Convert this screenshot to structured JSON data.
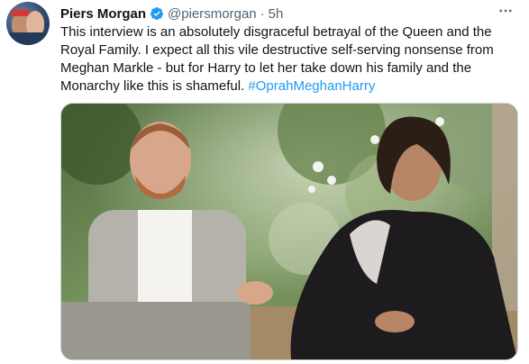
{
  "tweet": {
    "author_name": "Piers Morgan",
    "handle": "@piersmorgan",
    "separator": "·",
    "time": "5h",
    "text": "This interview is an absolutely disgraceful betrayal of the Queen and the Royal Family. I expect all this vile destructive self-serving nonsense from Meghan Markle - but for Harry to let her take down his family and the Monarchy like this is shameful.",
    "hashtag": "#OprahMeghanHarry",
    "more_label": "···"
  },
  "icons": {
    "verified": "verified-badge-icon",
    "more": "more-options-icon"
  },
  "colors": {
    "link": "#1d9bf0",
    "verified": "#1d9bf0",
    "secondary_text": "#536471"
  }
}
